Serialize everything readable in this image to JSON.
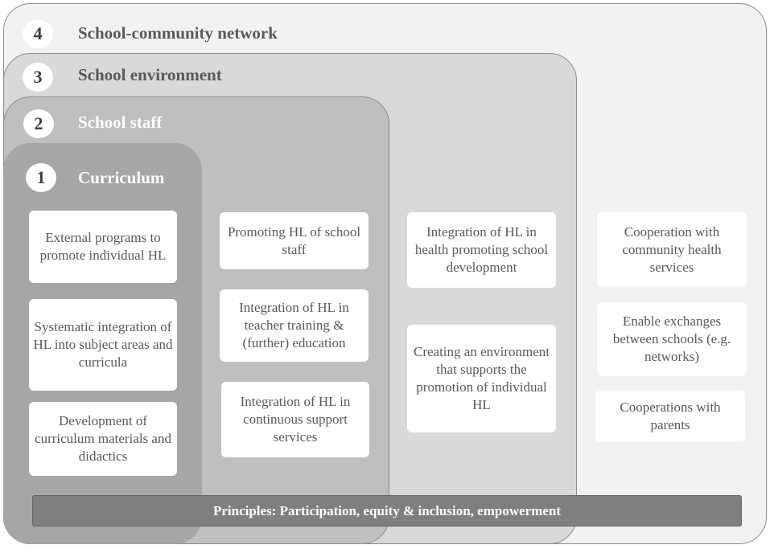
{
  "layers": [
    {
      "number": "4",
      "title": "School-community network",
      "color": "#f2f2f2"
    },
    {
      "number": "3",
      "title": "School environment",
      "color": "#d9d9d9"
    },
    {
      "number": "2",
      "title": "School staff",
      "color": "#bfbfbf"
    },
    {
      "number": "1",
      "title": "Curriculum",
      "color": "#a6a6a6"
    }
  ],
  "cards": {
    "curriculum": [
      "External programs to promote individual HL",
      "Systematic integration of HL into subject areas and curricula",
      "Development of curriculum materials and didactics"
    ],
    "staff": [
      "Promoting HL of school staff",
      "Integration of HL in teacher training & (further) education",
      "Integration of HL in continuous support services"
    ],
    "environment": [
      "Integration of HL in health promoting school development",
      "Creating an environment that supports the promotion of individual HL"
    ],
    "network": [
      "Cooperation with community health services",
      "Enable exchanges between schools (e.g. networks)",
      "Cooperations with parents"
    ]
  },
  "principles": "Principles: Participation, equity & inclusion, empowerment"
}
